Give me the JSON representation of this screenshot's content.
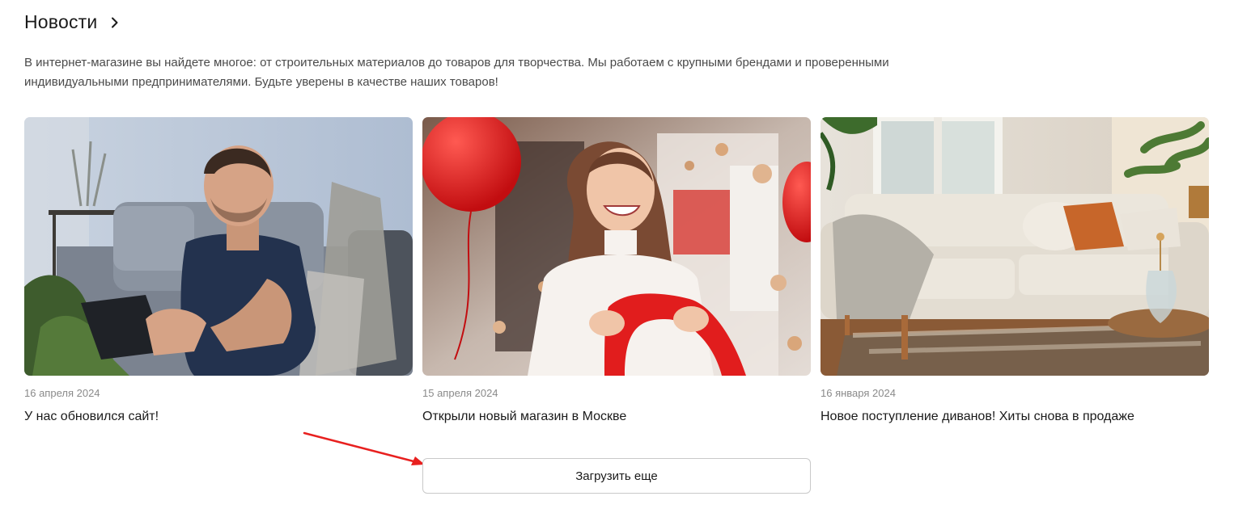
{
  "news": {
    "title": "Новости",
    "intro": "В интернет-магазине вы найдете многое: от строительных материалов до товаров для творчества. Мы работаем с крупными брендами и проверенными индивидуальными предпринимателями. Будьте уверены в качестве наших товаров!",
    "cards": [
      {
        "date": "16 апреля 2024",
        "title": "У нас обновился сайт!",
        "image": "man-with-tablet-on-sofa-photo"
      },
      {
        "date": "15 апреля 2024",
        "title": "Открыли новый магазин в Москве",
        "image": "smiling-woman-red-ribbon-balloons-photo"
      },
      {
        "date": "16 января 2024",
        "title": "Новое поступление диванов! Хиты снова в продаже",
        "image": "beige-sofa-in-living-room-photo"
      }
    ],
    "load_more_label": "Загрузить еще"
  },
  "colors": {
    "accent_arrow": "#e8201f",
    "text": "#1a1a1a",
    "muted": "#8a8a8a",
    "border": "#c9c9c9"
  }
}
